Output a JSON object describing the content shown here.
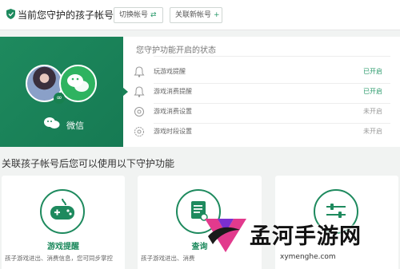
{
  "header": {
    "title": "当前您守护的孩子帐号",
    "switch_label": "切换帐号",
    "add_label": "关联新帐号"
  },
  "account": {
    "platform_label": "微信"
  },
  "status": {
    "title": "您守护功能开启的状态",
    "rows": [
      {
        "label": "玩游戏提醒",
        "value": "已开启",
        "on": true
      },
      {
        "label": "游戏消费提醒",
        "value": "已开启",
        "on": true
      },
      {
        "label": "游戏消费设置",
        "value": "未开启",
        "on": false
      },
      {
        "label": "游戏时段设置",
        "value": "未开启",
        "on": false
      }
    ]
  },
  "features": {
    "section_title": "关联孩子帐号后您可以使用以下守护功能",
    "cards": [
      {
        "title": "游戏提醒",
        "desc": "孩子游戏进出、消费信息，您可同步掌控"
      },
      {
        "title": "查询",
        "desc": "孩子游戏进出、消费"
      },
      {
        "title": "",
        "desc": ""
      }
    ]
  },
  "watermark": {
    "title": "孟河手游网",
    "url": "xymenghe.com"
  },
  "colors": {
    "brand_green": "#1e8a5e",
    "on_text": "#2a9a6b",
    "off_text": "#999999"
  }
}
